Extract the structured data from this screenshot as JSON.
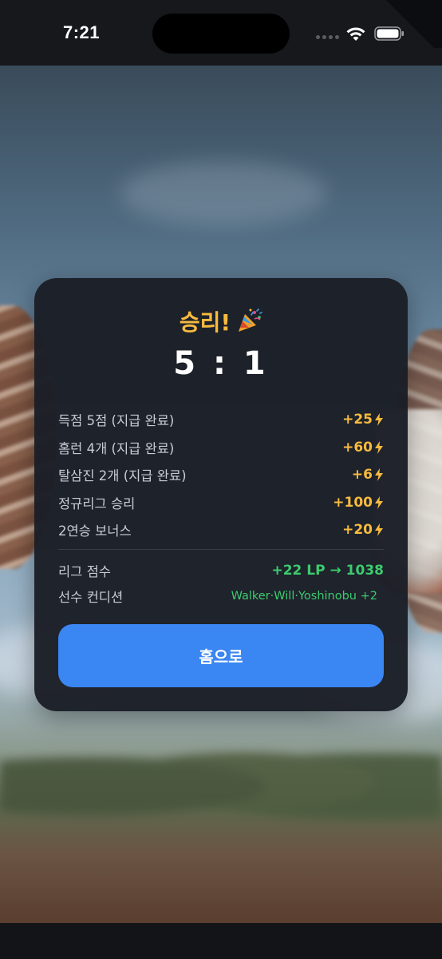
{
  "status_bar": {
    "time": "7:21",
    "icons": [
      "signal-dots-icon",
      "wifi-icon",
      "battery-icon"
    ]
  },
  "result": {
    "title": "승리!",
    "title_icon": "party-popper-icon",
    "score": "5 : 1",
    "rewards": [
      {
        "label": "득점 5점 (지급 완료)",
        "value": "+25"
      },
      {
        "label": "홈런 4개 (지급 완료)",
        "value": "+60"
      },
      {
        "label": "탈삼진 2개 (지급 완료)",
        "value": "+6"
      },
      {
        "label": "정규리그 승리",
        "value": "+100"
      },
      {
        "label": "2연승 보너스",
        "value": "+20"
      }
    ],
    "reward_icon": "lightning-bolt-icon",
    "league": {
      "label": "리그 점수",
      "value": "+22 LP → 1038"
    },
    "condition": {
      "label": "선수 컨디션",
      "value": "Walker·Will·Yoshinobu +2"
    },
    "home_button_label": "홈으로"
  },
  "colors": {
    "accent_gold": "#f7bb3f",
    "positive_green": "#3ccb6f",
    "button_blue": "#3a86f2",
    "card_bg": "#1b1e26"
  }
}
